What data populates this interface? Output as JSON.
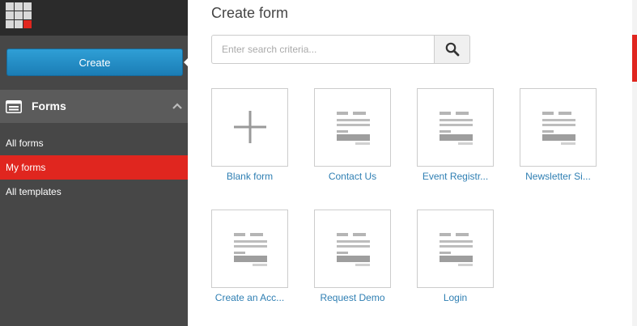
{
  "sidebar": {
    "create_label": "Create",
    "section_title": "Forms",
    "items": [
      {
        "label": "All forms"
      },
      {
        "label": "My forms"
      },
      {
        "label": "All templates"
      }
    ]
  },
  "main": {
    "title": "Create form",
    "search": {
      "placeholder": "Enter search criteria...",
      "value": ""
    },
    "tiles": [
      {
        "label": "Blank form"
      },
      {
        "label": "Contact Us"
      },
      {
        "label": "Event Registr..."
      },
      {
        "label": "Newsletter Si..."
      },
      {
        "label": "Create an Acc..."
      },
      {
        "label": "Request Demo"
      },
      {
        "label": "Login"
      }
    ]
  },
  "colors": {
    "accent": "#1b7db5",
    "active": "#e0261f",
    "sidebar": "#474747",
    "link": "#2f7fb3"
  }
}
